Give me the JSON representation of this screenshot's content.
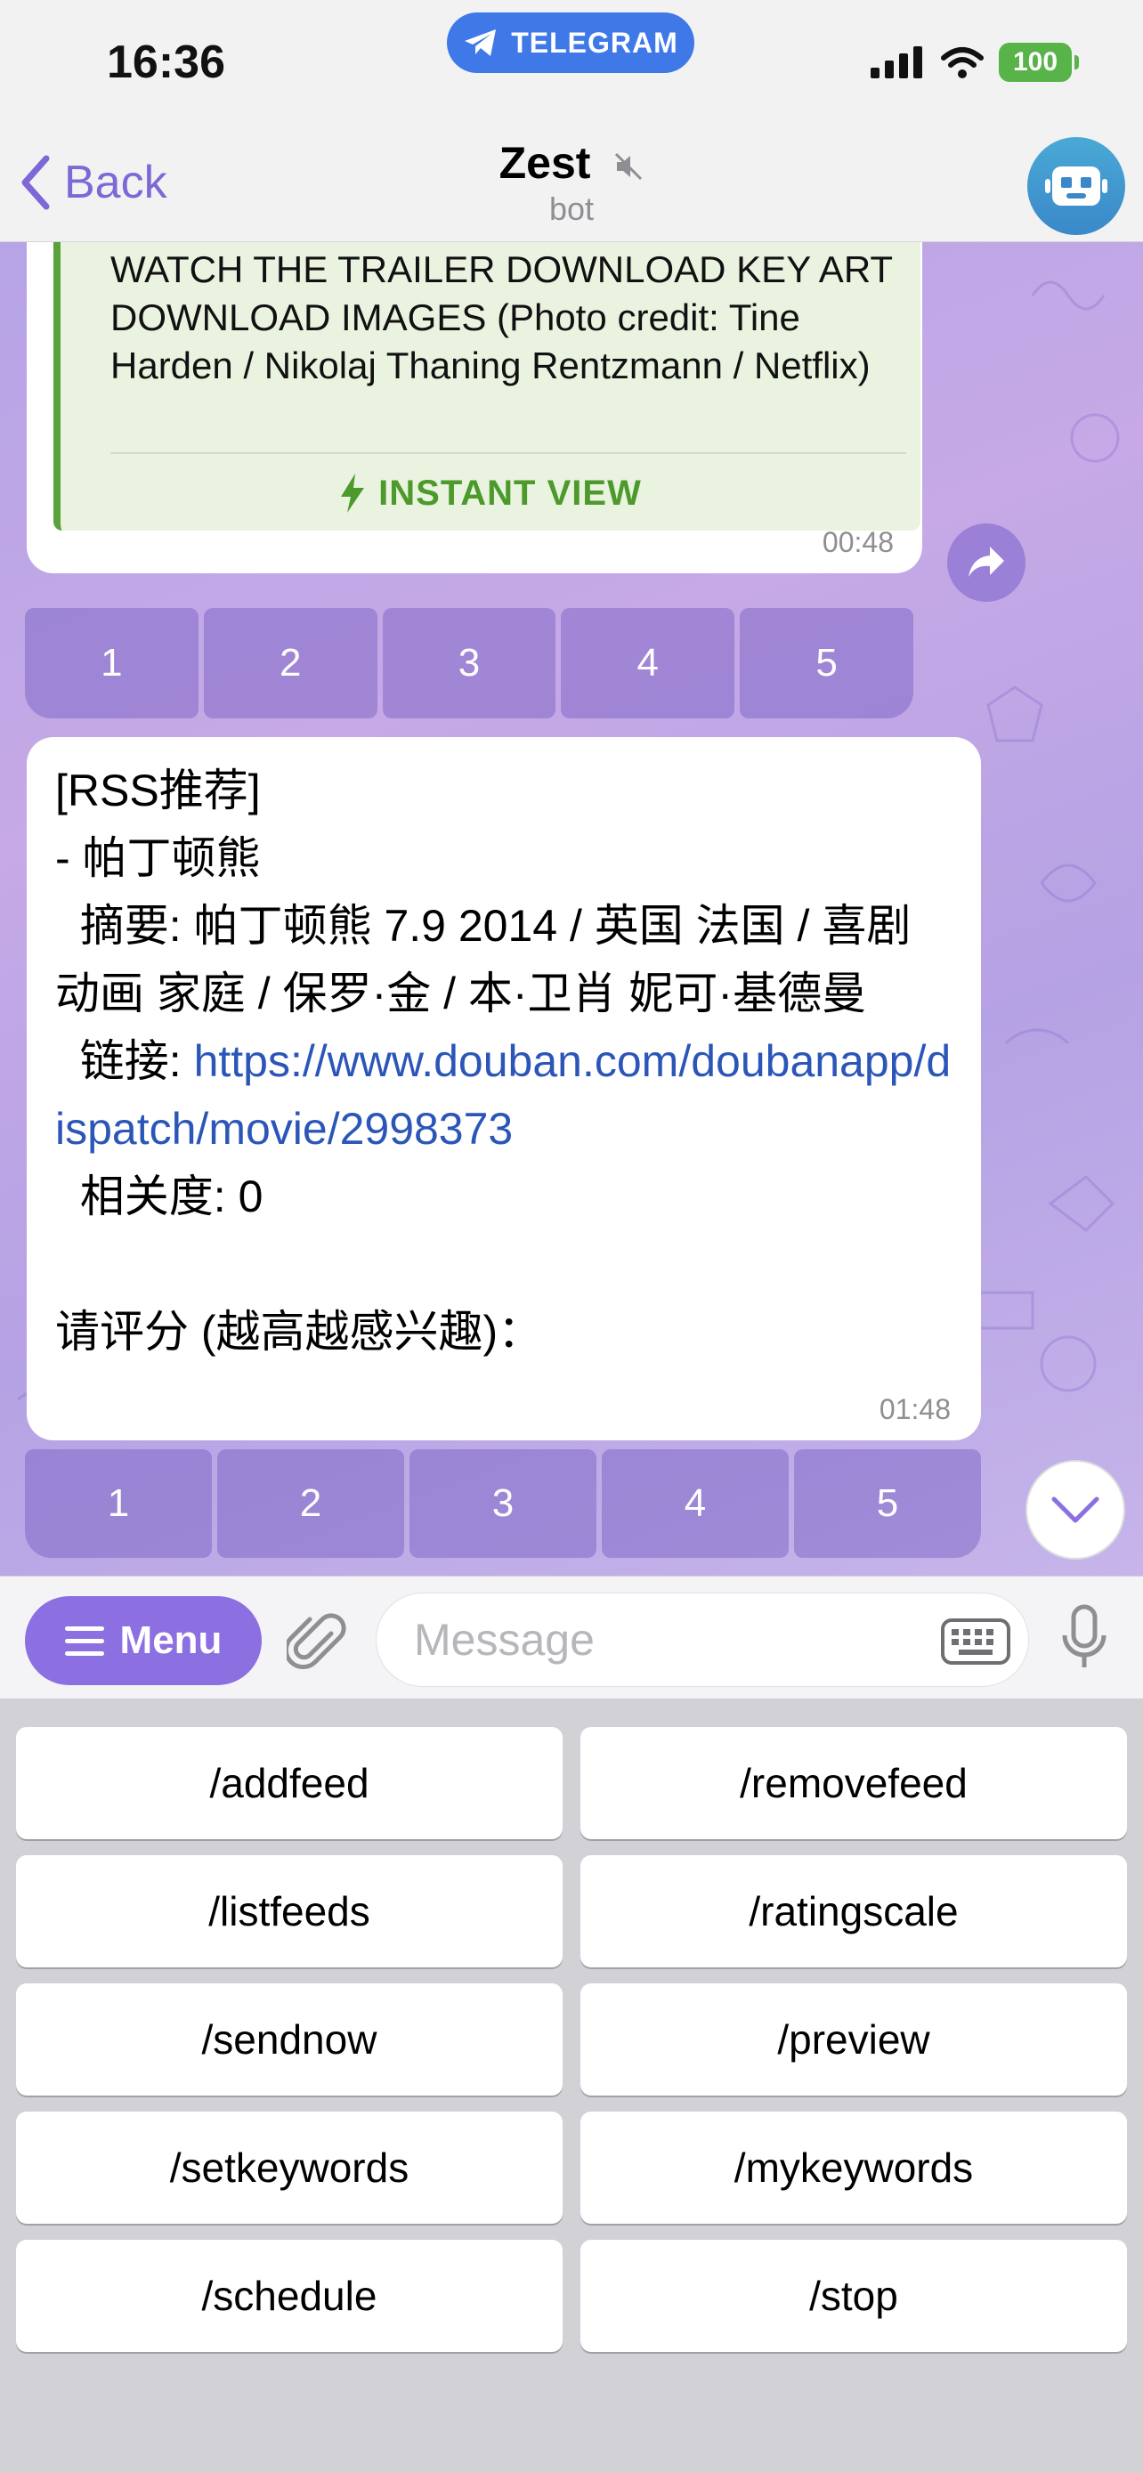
{
  "status_bar": {
    "time": "16:36",
    "app_pill": "TELEGRAM",
    "battery": "100"
  },
  "header": {
    "back_label": "Back",
    "title": "Zest",
    "subtitle": "bot"
  },
  "messages": [
    {
      "preview_text": "WATCH THE TRAILER  DOWNLOAD KEY ART DOWNLOAD IMAGES (Photo credit: Tine Harden / Nikolaj Thaning Rentzmann / Netflix)",
      "instant_view_label": "INSTANT VIEW",
      "time": "00:48",
      "rating_buttons": [
        "1",
        "2",
        "3",
        "4",
        "5"
      ]
    },
    {
      "lines": [
        "[RSS推荐]",
        "- 帕丁顿熊",
        "  摘要: 帕丁顿熊 7.9 2014 / 英国 法国 / 喜剧 动画 家庭 / 保罗·金 / 本·卫肖 妮可·基德曼"
      ],
      "link_label": "  链接: ",
      "link_url": "https://www.douban.com/doubanapp/dispatch/movie/2998373",
      "relevance": "  相关度: 0",
      "prompt": "请评分 (越高越感兴趣)：",
      "time": "01:48",
      "rating_buttons": [
        "1",
        "2",
        "3",
        "4",
        "5"
      ]
    }
  ],
  "input_bar": {
    "menu_label": "Menu",
    "placeholder": "Message"
  },
  "bot_keyboard": [
    [
      "/addfeed",
      "/removefeed"
    ],
    [
      "/listfeeds",
      "/ratingscale"
    ],
    [
      "/sendnow",
      "/preview"
    ],
    [
      "/setkeywords",
      "/mykeywords"
    ],
    [
      "/schedule",
      "/stop"
    ]
  ],
  "colors": {
    "accent": "#7d68d6",
    "chat_bg": "#c0a9e6",
    "instant_view": "#4c9a2b",
    "link": "#2b56b8",
    "keyboard_bg": "#d1d1d6"
  }
}
